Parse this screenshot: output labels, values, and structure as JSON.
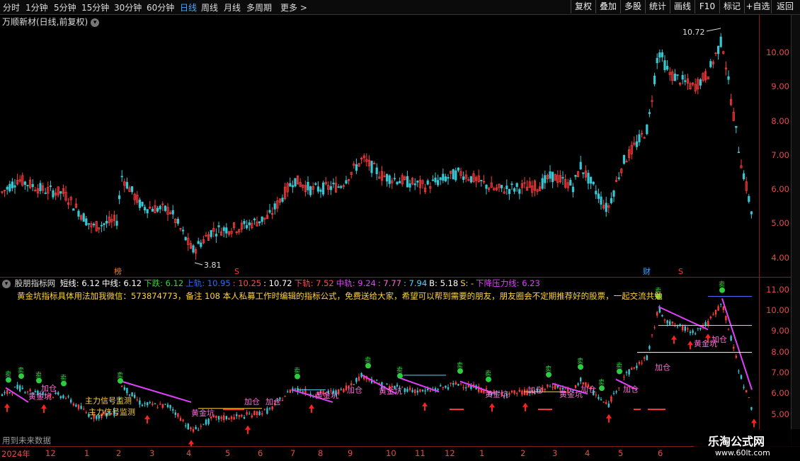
{
  "toolbar": {
    "tabs": [
      "分时",
      "1分钟",
      "5分钟",
      "15分钟",
      "30分钟",
      "60分钟",
      "日线",
      "周线",
      "月线",
      "多周期",
      "更多 >"
    ],
    "active_tab": "日线",
    "right_buttons": [
      "复权",
      "叠加",
      "多股",
      "统计",
      "画线",
      "F10",
      "标记",
      "+自选",
      "返回"
    ]
  },
  "stock": {
    "title": "万顺新材(日线,前复权)"
  },
  "price_axis": {
    "ticks": [
      "10.00",
      "9.00",
      "8.00",
      "7.00",
      "6.00",
      "5.00",
      "4.00"
    ]
  },
  "annotations": {
    "high": "10.72",
    "low": "3.81"
  },
  "event_markers": {
    "left": "榜",
    "s1": "S",
    "fin": "财",
    "s2": "S"
  },
  "indicator": {
    "name": "股朋指标网",
    "fields": [
      {
        "label": "短线: 6.12",
        "color": "#ffffff"
      },
      {
        "label": "中线: 6.12",
        "color": "#ffffff"
      },
      {
        "label": "下跌: 6.12",
        "color": "#35d435"
      },
      {
        "label": "上轨: 10.95",
        "color": "#2b6cff"
      },
      {
        "label": ": 10.25",
        "color": "#ff4d4d"
      },
      {
        "label": ": 10.72",
        "color": "#ffffff"
      },
      {
        "label": "下轨: 7.52",
        "color": "#ff4d4d"
      },
      {
        "label": "中轨: 9.24",
        "color": "#e040fb"
      },
      {
        "label": ": 7.77",
        "color": "#ff6bd6"
      },
      {
        "label": ": 7.94",
        "color": "#4dd9ff"
      },
      {
        "label": "B: 5.18",
        "color": "#ffffff"
      },
      {
        "label": "S: -",
        "color": "#ffd43b"
      },
      {
        "label": "下降压力线: 6.23",
        "color": "#e040fb"
      }
    ],
    "ticker": "黄金坑指标具体用法加我微信：573874773，备注 108 本人私募工作时编辑的指标公式，免费送给大家，希望可以帮到需要的朋友，朋友圈会不定期推荐好的股票，一起交流共勉",
    "ticks": [
      "11.00",
      "10.00",
      "9.00",
      "8.00",
      "7.00",
      "6.00",
      "5.00"
    ],
    "labels": {
      "golden_pit": "黄金坑",
      "add": "加仓",
      "main_monitor": "主力信号监测",
      "sell": "卖"
    }
  },
  "date_axis": [
    "2024年",
    "12",
    "1",
    "2",
    "3",
    "4",
    "5",
    "6",
    "7",
    "8",
    "9",
    "10",
    "11",
    "12",
    "1",
    "2",
    "3",
    "4",
    "5",
    "6"
  ],
  "future_label": "用到未来数据",
  "watermark": {
    "line1": "乐淘公式网",
    "line2": "www.60lt.com"
  },
  "colors": {
    "up": "#ff3b3b",
    "down": "#35c8d4",
    "axis": "#e84a4a",
    "accent": "#3fa9ff"
  }
}
